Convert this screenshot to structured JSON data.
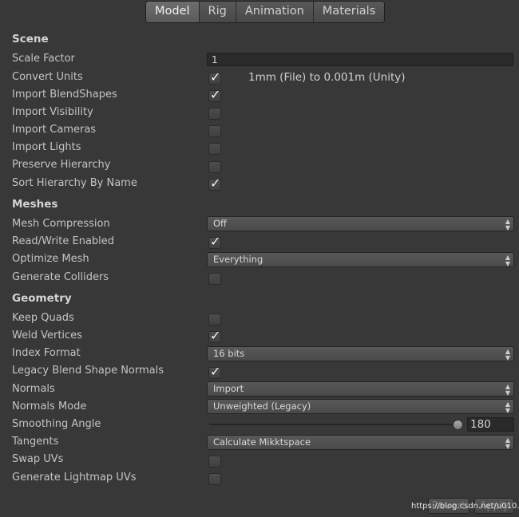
{
  "tabs": [
    "Model",
    "Rig",
    "Animation",
    "Materials"
  ],
  "scene": {
    "header": "Scene",
    "scale_factor_label": "Scale Factor",
    "scale_factor_value": "1",
    "convert_units_label": "Convert Units",
    "convert_units_note": "1mm (File) to 0.001m (Unity)",
    "import_blendshapes_label": "Import BlendShapes",
    "import_visibility_label": "Import Visibility",
    "import_cameras_label": "Import Cameras",
    "import_lights_label": "Import Lights",
    "preserve_hierarchy_label": "Preserve Hierarchy",
    "sort_hierarchy_label": "Sort Hierarchy By Name"
  },
  "meshes": {
    "header": "Meshes",
    "mesh_compression_label": "Mesh Compression",
    "mesh_compression_value": "Off",
    "read_write_label": "Read/Write Enabled",
    "optimize_mesh_label": "Optimize Mesh",
    "optimize_mesh_value": "Everything",
    "generate_colliders_label": "Generate Colliders"
  },
  "geometry": {
    "header": "Geometry",
    "keep_quads_label": "Keep Quads",
    "weld_vertices_label": "Weld Vertices",
    "index_format_label": "Index Format",
    "index_format_value": "16 bits",
    "legacy_blend_label": "Legacy Blend Shape Normals",
    "normals_label": "Normals",
    "normals_value": "Import",
    "normals_mode_label": "Normals Mode",
    "normals_mode_value": "Unweighted (Legacy)",
    "smoothing_angle_label": "Smoothing Angle",
    "smoothing_angle_value": "180",
    "tangents_label": "Tangents",
    "tangents_value": "Calculate Mikktspace",
    "swap_uvs_label": "Swap UVs",
    "lightmap_uvs_label": "Generate Lightmap UVs"
  },
  "checkmark": "✓",
  "arrows_up": "▲",
  "arrows_down": "▼",
  "footer": {
    "revert_label": "Revert",
    "apply_label": "Apply",
    "watermark": "https://blog.csdn.net/u010..."
  }
}
